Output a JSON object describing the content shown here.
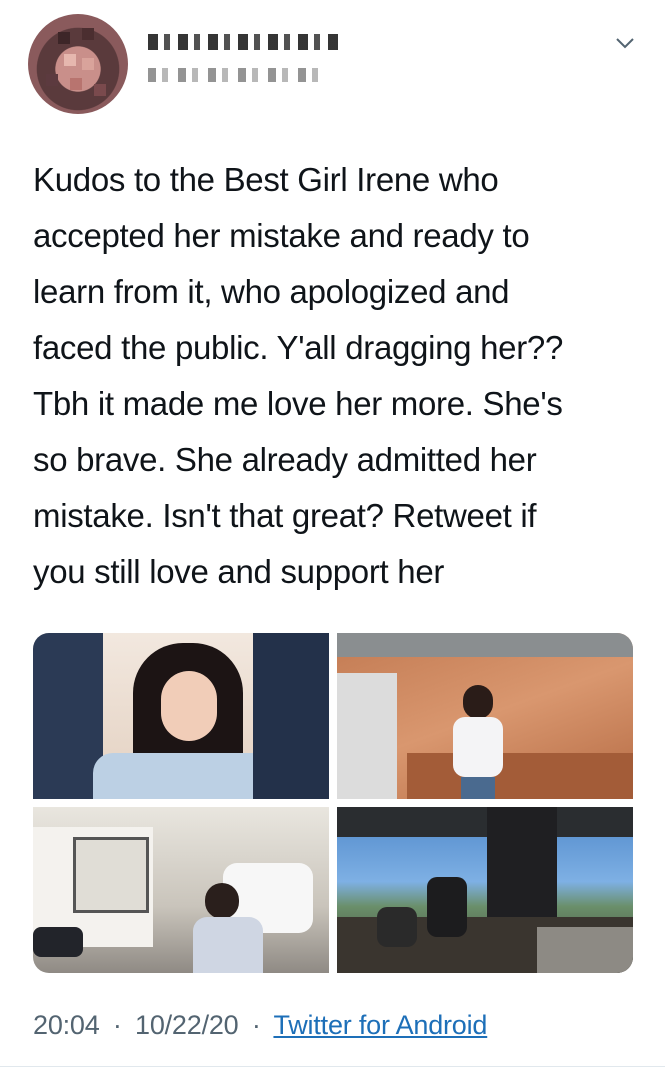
{
  "tweet": {
    "author": {
      "avatar_icon": "user-avatar-pixelated",
      "display_name": "",
      "handle": ""
    },
    "menu_icon": "chevron-down-icon",
    "lines": [
      "Kudos to the Best Girl Irene who",
      "accepted her mistake and ready to",
      "learn from it, who apologized and",
      "faced the public. Y'all dragging her??",
      "Tbh it made me love her more. She's",
      "so brave. She already admitted her",
      "mistake. Isn't that great? Retweet if",
      "you still love and support her"
    ],
    "media": {
      "count": 4
    },
    "meta": {
      "time": "20:04",
      "separator": "·",
      "date": "10/22/20",
      "source": "Twitter for Android"
    }
  },
  "colors": {
    "text": "#0f1419",
    "meta_text": "#536471",
    "link": "#1d6fb8",
    "divider": "#e1e8ed"
  }
}
